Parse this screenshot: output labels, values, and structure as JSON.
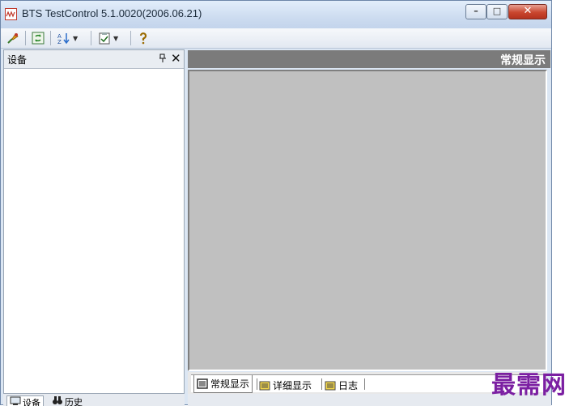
{
  "window": {
    "title": "BTS TestControl 5.1.0020(2006.06.21)",
    "controls": {
      "minimize": "–",
      "maximize": "□",
      "close": "✕"
    }
  },
  "toolbar": {
    "items": [
      {
        "icon": "connect-icon"
      },
      {
        "icon": "refresh-icon"
      },
      {
        "icon": "sort-icon",
        "has_dropdown": true
      },
      {
        "icon": "checklist-icon",
        "has_dropdown": true
      },
      {
        "icon": "help-icon"
      }
    ],
    "dropdown_glyph": "▼"
  },
  "left_panel": {
    "title": "设备",
    "pin_glyph": "q",
    "close_glyph": "✕",
    "tabs": [
      {
        "label": "设备",
        "icon": "device-icon",
        "active": true
      },
      {
        "label": "历史",
        "icon": "binoculars-icon",
        "active": false
      }
    ]
  },
  "main": {
    "header_title": "常规显示",
    "tabs": [
      {
        "label": "常规显示",
        "icon": "monitor-icon",
        "active": true
      },
      {
        "label": "详细显示",
        "icon": "folder-icon",
        "active": false
      },
      {
        "label": "日志",
        "icon": "folder-icon",
        "active": false
      }
    ]
  },
  "watermark": "最需网",
  "colors": {
    "title_bar": "#cddcf0",
    "panel_header": "#7b7b7b",
    "content_bg": "#c0c0c0",
    "watermark": "#7b1fa2"
  }
}
